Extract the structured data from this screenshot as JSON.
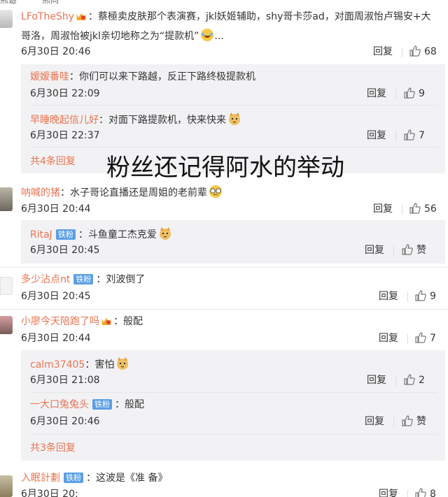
{
  "top_strip": {
    "left_text": "熊遊",
    "right_text": "熊同"
  },
  "comments": [
    {
      "user": "LFoTheShy",
      "text": "：蔡極卖皮肤那个表演赛，jkl妖姬辅助，shy哥卡莎ad，对面周淑怡卢锡安+大",
      "text_line2": "哥洛，周淑怡被jkl亲切地称之为“提款机”",
      "text_line2_tail": "...",
      "date": "6月30日 20:46",
      "reply": "回复",
      "likes": "68",
      "replies": [
        {
          "user": "嫒嫒番哇",
          "text": "：你们可以来下路越，反正下路终极提款机",
          "date": "6月30日 22:09",
          "reply": "回复",
          "likes": "9"
        },
        {
          "user": "早睡晚起信儿好",
          "text": "：对面下路提款机，快来快来",
          "date": "6月30日 22:37",
          "reply": "回复",
          "likes": "7"
        }
      ],
      "more_replies": "共4条回复"
    },
    {
      "user": "呐喊的猪",
      "text": "：水子哥论直播还是周姐的老前辈",
      "date": "6月30日 20:44",
      "reply": "回复",
      "likes": "56",
      "replies": [
        {
          "user": "RitaJ",
          "badge": "铁粉",
          "text": "：斗鱼童工杰克爱",
          "date": "6月30日 20:45",
          "reply": "回复",
          "likes": "赞"
        }
      ]
    },
    {
      "user": "多少沾点nt",
      "badge": "铁粉",
      "text": "：刘波倒了",
      "date": "6月30日 20:45",
      "reply": "回复",
      "likes": "9"
    },
    {
      "user": "小廖今天陪跑了吗",
      "text": "：般配",
      "date": "6月30日 20:44",
      "reply": "回复",
      "likes": "7",
      "replies": [
        {
          "user": "calm37405",
          "text": "：害怕",
          "date": "6月30日 21:08",
          "reply": "回复",
          "likes": "2"
        },
        {
          "user": "一大口兔兔头",
          "badge": "铁粉",
          "text": "：般配",
          "date": "6月30日 20:46",
          "reply": "回复",
          "likes": "赞"
        }
      ],
      "more_replies": "共3条回复"
    },
    {
      "user": "入眠計劃",
      "badge": "铁粉",
      "text": "：这波是《准 备》",
      "date": "6月30日 20:",
      "reply": "回复",
      "likes": "8"
    }
  ],
  "overlay_caption": "粉丝还记得阿水的举动",
  "colors": {
    "username": "#eb7350",
    "badge": "#5b9fe4",
    "subbox": "#f2f2f5"
  }
}
